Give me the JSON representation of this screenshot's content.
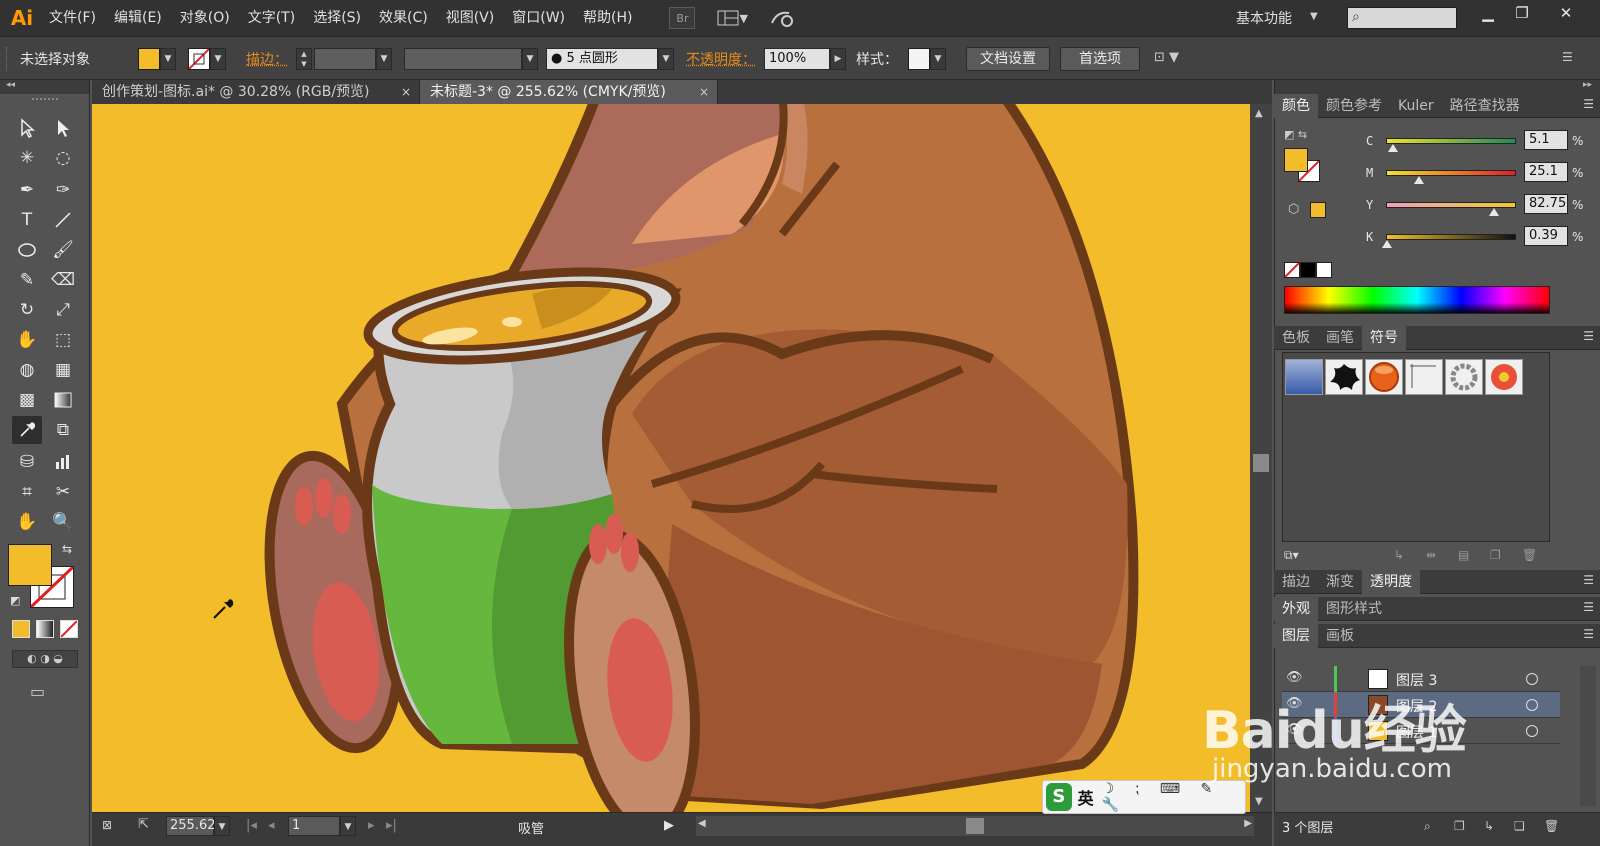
{
  "app": {
    "logo": "Ai",
    "menus": [
      "文件(F)",
      "编辑(E)",
      "对象(O)",
      "文字(T)",
      "选择(S)",
      "效果(C)",
      "视图(V)",
      "窗口(W)",
      "帮助(H)"
    ],
    "bridge_label": "Br",
    "workspace": "基本功能",
    "search_placeholder": ""
  },
  "controlbar": {
    "selection_status": "未选择对象",
    "fill_color": "#f2bc2a",
    "stroke_label": "描边：",
    "brush_label": "5 点圆形",
    "opacity_label": "不透明度：",
    "opacity_value": "100%",
    "style_label": "样式：",
    "doc_setup_button": "文档设置",
    "prefs_button": "首选项"
  },
  "doc_tabs": [
    {
      "label": "创作策划-图标.ai* @ 30.28% (RGB/预览)",
      "active": false
    },
    {
      "label": "未标题-3* @ 255.62% (CMYK/预览)",
      "active": true
    }
  ],
  "tab_close": "×",
  "statusbar": {
    "zoom": "255.62",
    "page": "1",
    "tool_status": "吸管"
  },
  "color_panel": {
    "tabs": [
      "颜色",
      "颜色参考",
      "Kuler",
      "路径查找器"
    ],
    "channels": [
      {
        "label": "C",
        "value": "5.1",
        "fraction": 0.051
      },
      {
        "label": "M",
        "value": "25.1",
        "fraction": 0.251
      },
      {
        "label": "Y",
        "value": "82.75",
        "fraction": 0.8275
      },
      {
        "label": "K",
        "value": "0.39",
        "fraction": 0.0039
      }
    ],
    "pct": "%"
  },
  "swatch_panel": {
    "tabs": [
      "色板",
      "画笔",
      "符号"
    ]
  },
  "transparency_panel": {
    "tabs": [
      "描边",
      "渐变",
      "透明度"
    ]
  },
  "appearance_panel": {
    "tabs": [
      "外观",
      "图形样式"
    ]
  },
  "layers_panel": {
    "tabs": [
      "图层",
      "画板"
    ],
    "layers": [
      {
        "name": "图层 3",
        "color": "#4fc84f",
        "selected": false
      },
      {
        "name": "图层 2",
        "color": "#e04040",
        "selected": true
      },
      {
        "name": "图层 1",
        "color": "#3a6be8",
        "selected": false
      }
    ],
    "footer": "3 个图层"
  },
  "ime": {
    "logo": "S",
    "lang": "英"
  },
  "watermark": {
    "main": "Baidu经验",
    "sub": "jingyan.baidu.com"
  },
  "icons": {
    "tools": [
      "selection-icon",
      "direct-selection-icon",
      "magic-wand-icon",
      "lasso-icon",
      "pen-icon",
      "curvature-icon",
      "type-icon",
      "line-icon",
      "ellipse-icon",
      "brush-icon",
      "pencil-icon",
      "eraser-icon",
      "rotate-icon",
      "scale-icon",
      "warp-icon",
      "free-transform-icon",
      "shape-builder-icon",
      "perspective-icon",
      "mesh-icon",
      "gradient-icon",
      "eyedropper-icon",
      "blend-icon",
      "symbol-sprayer-icon",
      "graph-icon",
      "artboard-icon",
      "slice-icon",
      "hand-icon",
      "zoom-icon"
    ]
  }
}
